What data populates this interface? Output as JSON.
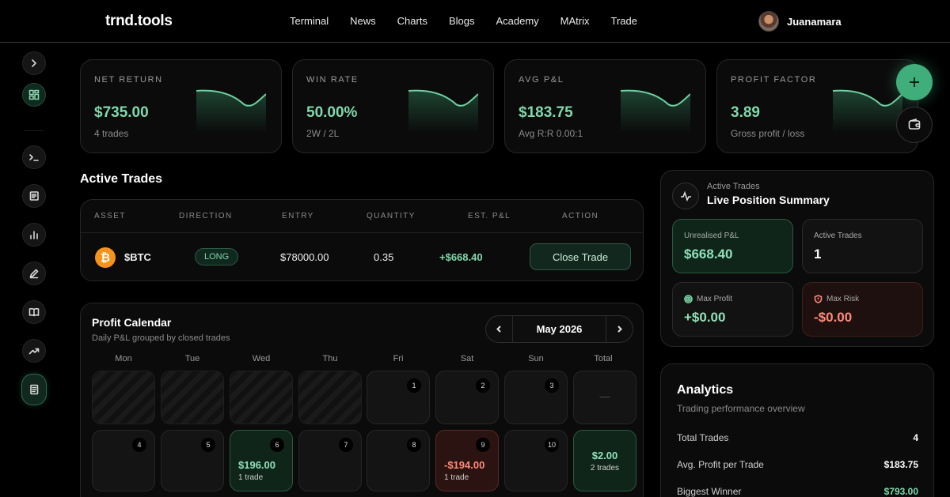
{
  "brand": "trnd.tools",
  "nav": [
    "Terminal",
    "News",
    "Charts",
    "Blogs",
    "Academy",
    "MAtrix",
    "Trade"
  ],
  "user": {
    "name": "Juanamara"
  },
  "sidebar": {
    "icons": [
      "chevron-right-icon",
      "dashboard-grid-icon",
      "terminal-icon",
      "news-icon",
      "chart-bars-icon",
      "pen-icon",
      "book-icon",
      "trending-up-icon",
      "journal-icon"
    ]
  },
  "stats": [
    {
      "label": "NET RETURN",
      "value": "$735.00",
      "sub": "4 trades"
    },
    {
      "label": "WIN RATE",
      "value": "50.00%",
      "sub": "2W / 2L"
    },
    {
      "label": "AVG P&L",
      "value": "$183.75",
      "sub": "Avg R:R 0.00:1"
    },
    {
      "label": "PROFIT FACTOR",
      "value": "3.89",
      "sub": "Gross profit / loss"
    }
  ],
  "active_trades": {
    "title": "Active Trades",
    "headers": [
      "ASSET",
      "DIRECTION",
      "ENTRY",
      "QUANTITY",
      "EST. P&L",
      "ACTION"
    ],
    "rows": [
      {
        "asset": "$BTC",
        "direction": "LONG",
        "entry": "$78000.00",
        "quantity": "0.35",
        "pnl": "+$668.40",
        "action": "Close Trade"
      }
    ]
  },
  "calendar": {
    "title": "Profit Calendar",
    "subtitle": "Daily P&L grouped by closed trades",
    "month": "May 2026",
    "weekdays": [
      "Mon",
      "Tue",
      "Wed",
      "Thu",
      "Fri",
      "Sat",
      "Sun",
      "Total"
    ],
    "week1": {
      "days": [
        "1",
        "2",
        "3"
      ],
      "total": "—"
    },
    "week2": {
      "days": [
        "4",
        "5",
        "6",
        "7",
        "8",
        "9",
        "10"
      ],
      "wed": {
        "amount": "$196.00",
        "trades": "1 trade"
      },
      "sat": {
        "amount": "-$194.00",
        "trades": "1 trade"
      },
      "total": {
        "amount": "$2.00",
        "trades": "2 trades"
      }
    }
  },
  "summary": {
    "kicker": "Active Trades",
    "title": "Live Position Summary",
    "unrealised_label": "Unrealised P&L",
    "unrealised_value": "$668.40",
    "active_label": "Active Trades",
    "active_value": "1",
    "max_profit_label": "Max Profit",
    "max_profit_value": "+$0.00",
    "max_risk_label": "Max Risk",
    "max_risk_value": "-$0.00"
  },
  "analytics": {
    "title": "Analytics",
    "subtitle": "Trading performance overview",
    "rows": [
      {
        "label": "Total Trades",
        "value": "4"
      },
      {
        "label": "Avg. Profit per Trade",
        "value": "$183.75"
      },
      {
        "label": "Biggest Winner",
        "value": "$793.00"
      }
    ]
  },
  "colors": {
    "accent": "#7fd9ab",
    "negative": "#ff8a7a",
    "fab": "#3fae7b",
    "btc": "#f7931a"
  }
}
